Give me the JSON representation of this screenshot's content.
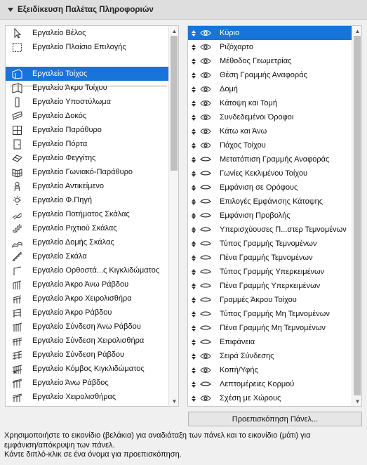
{
  "header": {
    "title": "Εξειδίκευση Παλέτας Πληροφοριών"
  },
  "left": {
    "items": [
      {
        "label": "Εργαλείο Βέλος",
        "icon": "arrow-pointer-icon"
      },
      {
        "label": "Εργαλείο Πλαίσιο Επιλογής",
        "icon": "marquee-icon"
      },
      {
        "label": "Εργαλείο Τοίχος",
        "icon": "wall-icon",
        "selected": true
      },
      {
        "label": "Εργαλείο Άκρο Τοίχου",
        "icon": "wall-end-icon"
      },
      {
        "label": "Εργαλείο Υποστύλωμα",
        "icon": "column-icon"
      },
      {
        "label": "Εργαλείο Δοκός",
        "icon": "beam-icon"
      },
      {
        "label": "Εργαλείο Παράθυρο",
        "icon": "window-icon"
      },
      {
        "label": "Εργαλείο Πόρτα",
        "icon": "door-icon"
      },
      {
        "label": "Εργαλείο Φεγγίτης",
        "icon": "skylight-icon"
      },
      {
        "label": "Εργαλείο Γωνιακό-Παράθυρο",
        "icon": "corner-window-icon"
      },
      {
        "label": "Εργαλείο Αντικείμενο",
        "icon": "object-icon"
      },
      {
        "label": "Εργαλείο Φ.Πηγή",
        "icon": "lamp-icon"
      },
      {
        "label": "Εργαλείο Ποτήματος Σκάλας",
        "icon": "stair-tread-icon"
      },
      {
        "label": "Εργαλείο Ριχτιού Σκάλας",
        "icon": "stair-riser-icon"
      },
      {
        "label": "Εργαλείο Δομής Σκάλας",
        "icon": "stair-structure-icon"
      },
      {
        "label": "Εργαλείο Σκάλα",
        "icon": "stair-icon"
      },
      {
        "label": "Εργαλείο Ορθοστά...ς Κιγκλιδώματος",
        "icon": "railing-post-icon"
      },
      {
        "label": "Εργαλείο Άκρο Άνω Ράβδου",
        "icon": "top-rail-end-icon"
      },
      {
        "label": "Εργαλείο Άκρο Χειρολισθήρα",
        "icon": "handrail-end-icon"
      },
      {
        "label": "Εργαλείο Άκρο Ράβδου",
        "icon": "rail-end-icon"
      },
      {
        "label": "Εργαλείο Σύνδεση Άνω Ράβδου",
        "icon": "top-rail-connection-icon"
      },
      {
        "label": "Εργαλείο Σύνδεση Χειρολισθήρα",
        "icon": "handrail-connection-icon"
      },
      {
        "label": "Εργαλείο Σύνδεση Ράβδου",
        "icon": "rail-connection-icon"
      },
      {
        "label": "Εργαλείο Κόμβος Κιγκλιδώματος",
        "icon": "railing-node-icon"
      },
      {
        "label": "Εργαλείο Άνω Ράβδος",
        "icon": "top-rail-icon"
      },
      {
        "label": "Εργαλείο Χειρολισθήρας",
        "icon": "handrail-icon"
      }
    ]
  },
  "right": {
    "items": [
      {
        "label": "Κύριο",
        "visible": true,
        "selected": true
      },
      {
        "label": "Ριζόχαρτο",
        "visible": true
      },
      {
        "label": "Μέθοδος Γεωμετρίας",
        "visible": true
      },
      {
        "label": "Θέση Γραμμής Αναφοράς",
        "visible": true
      },
      {
        "label": "Δομή",
        "visible": true
      },
      {
        "label": "Κάτοψη και Τομή",
        "visible": true
      },
      {
        "label": "Συνδεδεμένοι Όροφοι",
        "visible": true
      },
      {
        "label": "Κάτω και Άνω",
        "visible": true
      },
      {
        "label": "Πάχος Τοίχου",
        "visible": true
      },
      {
        "label": "Μετατόπιση Γραμμής Αναφοράς",
        "visible": false
      },
      {
        "label": "Γωνίες Κεκλιμένου Τοίχου",
        "visible": false
      },
      {
        "label": "Εμφάνιση σε Ορόφους",
        "visible": false
      },
      {
        "label": "Επιλογές Εμφάνισης Κάτοψης",
        "visible": false
      },
      {
        "label": "Εμφάνιση Προβολής",
        "visible": false
      },
      {
        "label": "Υπερισχύουσες Π...στερ Τεμνομένων",
        "visible": false
      },
      {
        "label": "Τύπος Γραμμής Τεμνομένων",
        "visible": false
      },
      {
        "label": "Πένα Γραμμής Τεμνομένων",
        "visible": false
      },
      {
        "label": "Τύπος Γραμμής Υπερκειμένων",
        "visible": false
      },
      {
        "label": "Πένα Γραμμής Υπερκειμένων",
        "visible": false
      },
      {
        "label": "Γραμμές Άκρου Τοίχου",
        "visible": false
      },
      {
        "label": "Τύπος Γραμμής Μη Τεμνομένων",
        "visible": false
      },
      {
        "label": "Πένα Γραμμής Μη Τεμνομένων",
        "visible": false
      },
      {
        "label": "Επιφάνεια",
        "visible": false
      },
      {
        "label": "Σειρά Σύνδεσης",
        "visible": true
      },
      {
        "label": "Κοπή/Υφής",
        "visible": true
      },
      {
        "label": "Λεπτομέρειες Κορμού",
        "visible": false
      },
      {
        "label": "Σχέση με Χώρους",
        "visible": true
      }
    ]
  },
  "preview_button": "Προεπισκόπηση Πάνελ...",
  "help": {
    "line1": "Χρησιμοποιήστε το εικονίδιο (βελάκια) για αναδιάταξη των πάνελ και το εικονίδιο (μάτι) για",
    "line2": "εμφάνιση/απόκρυψη των πάνελ.",
    "line3": "Κάντε διπλό-κλικ σε ένα όνομα για προεπισκόπηση."
  },
  "colors": {
    "selection": "#1874d8",
    "header_bg": "#dedede"
  }
}
